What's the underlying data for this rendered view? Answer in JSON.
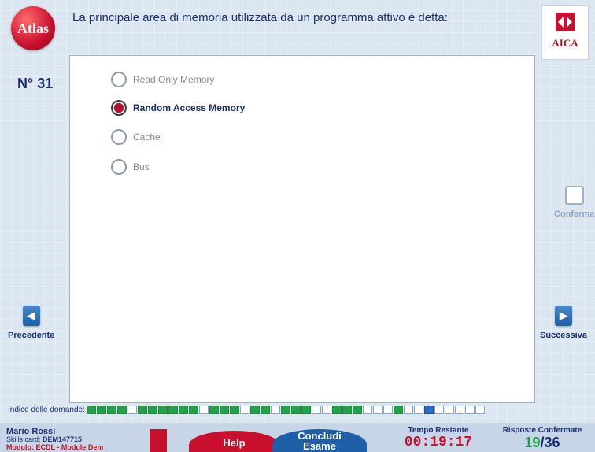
{
  "header": {
    "logo_text": "Atlas",
    "question": "La principale area di memoria utilizzata da un programma attivo è detta:",
    "aica_label": "AICA"
  },
  "question_number": "N° 31",
  "options": [
    {
      "label": "Read Only Memory",
      "selected": false
    },
    {
      "label": "Random Access Memory",
      "selected": true
    },
    {
      "label": "Cache",
      "selected": false
    },
    {
      "label": "Bus",
      "selected": false
    }
  ],
  "nav": {
    "confirm_label": "Conferma",
    "prev_label": "Precedente",
    "next_label": "Successiva"
  },
  "index": {
    "label": "Indice delle domande:",
    "states": [
      "a",
      "a",
      "a",
      "a",
      "e",
      "a",
      "a",
      "a",
      "a",
      "a",
      "a",
      "e",
      "a",
      "a",
      "a",
      "e",
      "a",
      "a",
      "e",
      "a",
      "a",
      "a",
      "e",
      "e",
      "a",
      "a",
      "a",
      "e",
      "e",
      "e",
      "a",
      "e",
      "e",
      "c",
      "e",
      "e",
      "e",
      "e",
      "e"
    ]
  },
  "footer": {
    "user_name": "Mario Rossi",
    "skills_prefix": "Skills card:",
    "skills_id": "DEM147715",
    "module": "Modulo: ECDL - Module Dem",
    "help_label": "Help",
    "end_label_1": "Concludi",
    "end_label_2": "Esame",
    "time_title": "Tempo Restante",
    "time_value": "00:19:17",
    "confirmed_title": "Risposte Confermate",
    "confirmed_done": "19",
    "confirmed_total": "/36"
  },
  "colors": {
    "accent_red": "#c8102e",
    "accent_blue": "#1e5fa8",
    "answered_green": "#25a04a"
  }
}
